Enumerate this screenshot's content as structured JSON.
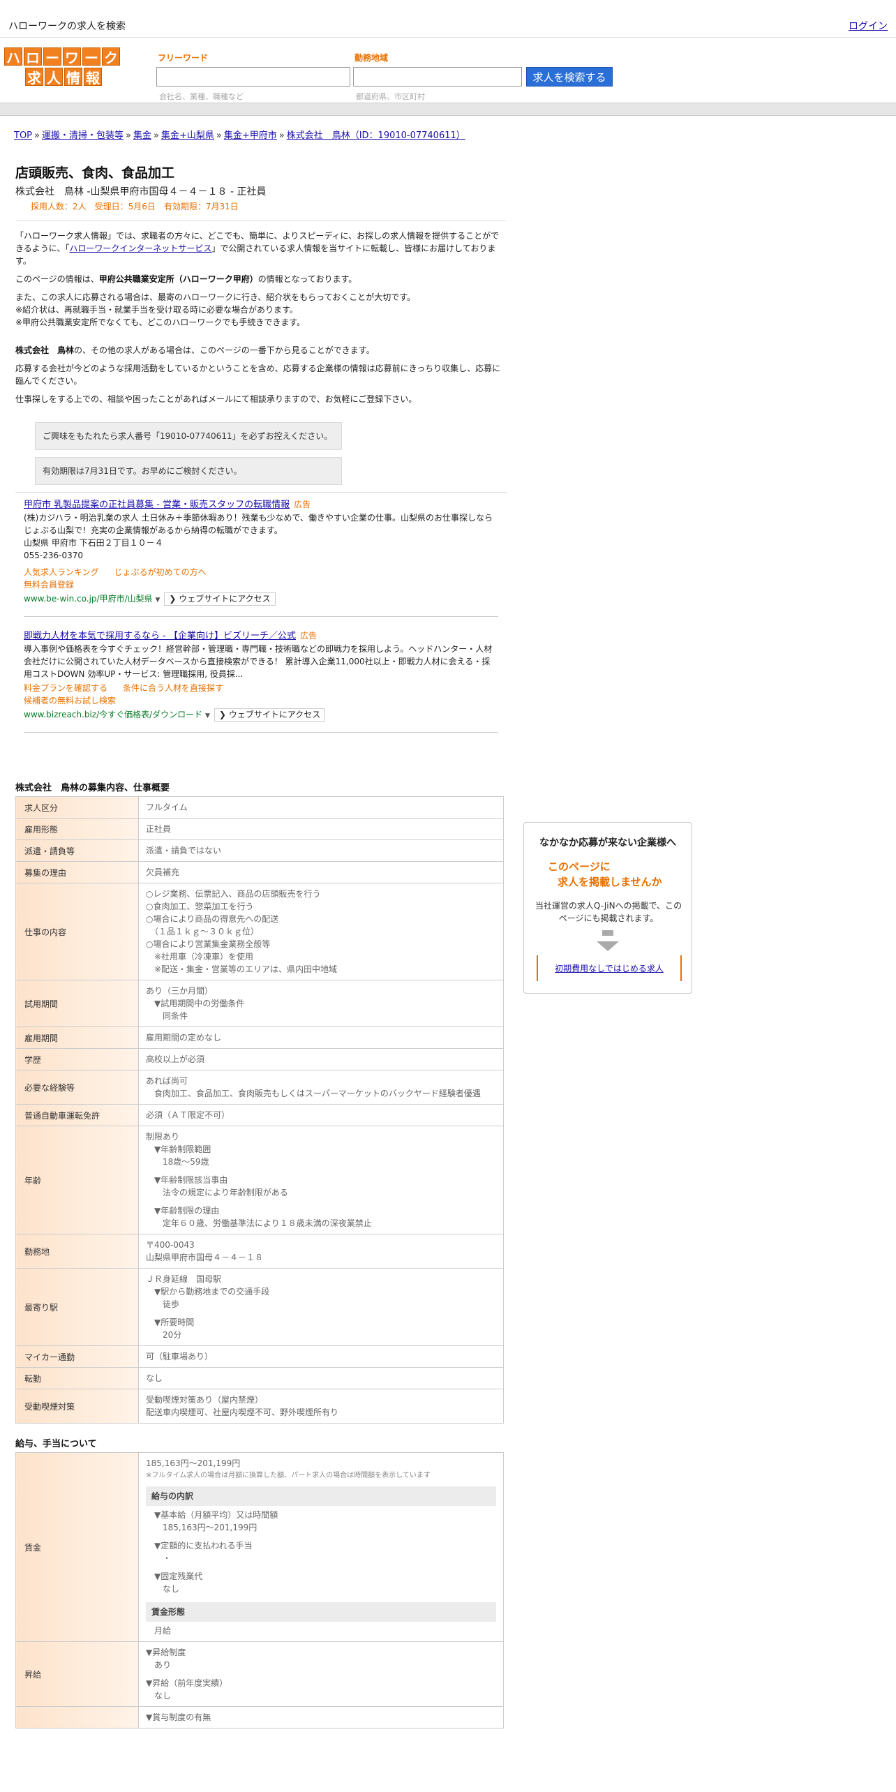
{
  "header": {
    "site_title": "ハローワークの求人を検索",
    "login": "ログイン",
    "logo_row1": [
      "ハ",
      "ロ",
      "ー",
      "ワ",
      "ー",
      "ク"
    ],
    "logo_row2": [
      "求",
      "人",
      "情",
      "報"
    ]
  },
  "search": {
    "keyword_label": "フリーワード",
    "keyword_hint": "会社名、業種、職種など",
    "area_label": "勤務地域",
    "area_hint": "都道府県、市区町村",
    "button": "求人を検索する"
  },
  "breadcrumb": [
    "TOP",
    "運搬・清掃・包装等",
    "集金",
    "集金+山梨県",
    "集金+甲府市",
    "株式会社　鳥林（ID：19010-07740611）"
  ],
  "job": {
    "title": "店頭販売、食肉、食品加工",
    "company_line": "株式会社　鳥林 -山梨県甲府市国母４－４－１８ - 正社員",
    "meta": "採用人数：2人　受理日：5月6日　有効期限：7月31日"
  },
  "intro": {
    "p1a": "「ハローワーク求人情報」では、求職者の方々に、どこでも、簡単に、よりスピーディに、お探しの求人情報を提供することができるように、「",
    "p1link": "ハローワークインターネットサービス",
    "p1b": "」で公開されている求人情報を当サイトに転載し、皆様にお届けしております。",
    "p2a": "このページの情報は、",
    "p2b": "甲府公共職業安定所（ハローワーク甲府）",
    "p2c": "の情報となっております。",
    "p3": "また、この求人に応募される場合は、最寄のハローワークに行き、紹介状をもらっておくことが大切です。",
    "p4": "※紹介状は、再就職手当・就業手当を受け取る時に必要な場合があります。",
    "p5": "※甲府公共職業安定所でなくても、どこのハローワークでも手続きできます。",
    "p6a": "株式会社　鳥林",
    "p6b": "の、その他の求人がある場合は、このページの一番下から見ることができます。",
    "p7": "応募する会社が今どのような採用活動をしているかということを含め、応募する企業様の情報は応募前にきっちり収集し、応募に臨んでください。",
    "p8": "仕事探しをする上での、相談や困ったことがあればメールにて相談承りますので、お気軽にご登録下さい。",
    "notice1": "ご興味をもたれたら求人番号「19010-07740611」を必ずお控えください。",
    "notice2": "有効期限は7月31日です。お早めにご検討ください。"
  },
  "ads": [
    {
      "title": "甲府市 乳製品提案の正社員募集 - 営業・販売スタッフの転職情報",
      "label": "広告",
      "text": "(株)カジハラ・明治乳業の求人 土日休み＋季節休暇あり！残業も少なめで、働きやすい企業の仕事。山梨県のお仕事探しならじょぶる山梨で！充実の企業情報があるから納得の転職ができます。",
      "address": "山梨県 甲府市 下石田２丁目１０－４",
      "phone": "055-236-0370",
      "links": [
        "人気求人ランキング",
        "じょぶるが初めての方へ",
        "無料会員登録"
      ],
      "url": "www.be-win.co.jp/甲府市/山梨県",
      "button": "ウェブサイトにアクセス"
    },
    {
      "title": "即戦力人材を本気で採用するなら - 【企業向け】ビズリーチ／公式",
      "label": "広告",
      "text": "導入事例や価格表を今すぐチェック！経営幹部・管理職・専門職・技術職などの即戦力を採用しよう。ヘッドハンター・人材会社だけに公開されていた人材データベースから直接検索ができる！ 累計導入企業11,000社以上・即戦力人材に会える・採用コストDOWN 効率UP・サービス: 管理職採用, 役員採...",
      "links": [
        "料金プランを確認する",
        "条件に合う人材を直接探す",
        "候補者の無料お試し検索"
      ],
      "url": "www.bizreach.biz/今すぐ価格表/ダウンロード",
      "button": "ウェブサイトにアクセス"
    }
  ],
  "overview": {
    "title": "株式会社　鳥林の募集内容、仕事概要",
    "rows": [
      {
        "k": "求人区分",
        "v": [
          "フルタイム"
        ]
      },
      {
        "k": "雇用形態",
        "v": [
          "正社員"
        ]
      },
      {
        "k": "派遣・請負等",
        "v": [
          "派遣・請負ではない"
        ]
      },
      {
        "k": "募集の理由",
        "v": [
          "欠員補充"
        ]
      },
      {
        "k": "仕事の内容",
        "v": [
          "○レジ業務、伝票記入、商品の店頭販売を行う",
          "○食肉加工、惣菜加工を行う",
          "○場合により商品の得意先への配送",
          "　（１品１ｋｇ～３０ｋｇ位）",
          "○場合により営業集金業務全般等",
          "　※社用車（冷凍車）を使用",
          "　※配送・集金・営業等のエリアは、県内田中地域"
        ]
      },
      {
        "k": "試用期間",
        "v": [
          "あり（三か月間）",
          "　▼試用期間中の労働条件",
          "　　同条件"
        ]
      },
      {
        "k": "雇用期間",
        "v": [
          "雇用期間の定めなし"
        ]
      },
      {
        "k": "学歴",
        "v": [
          "高校以上が必須"
        ]
      },
      {
        "k": "必要な経験等",
        "v": [
          "あれば尚可",
          "　食肉加工、食品加工、食肉販売もしくはスーパーマーケットのバックヤード経験者優遇"
        ]
      },
      {
        "k": "普通自動車運転免許",
        "v": [
          "必須（ＡＴ限定不可）"
        ]
      },
      {
        "k": "年齢",
        "v": [
          "制限あり",
          "　▼年齢制限範囲",
          "　　18歳〜59歳",
          "",
          "　▼年齢制限該当事由",
          "　　法令の規定により年齢制限がある",
          "",
          "　▼年齢制限の理由",
          "　　定年６０歳、労働基準法により１８歳未満の深夜業禁止"
        ]
      },
      {
        "k": "勤務地",
        "v": [
          "〒400-0043",
          "山梨県甲府市国母４－４－１８"
        ]
      },
      {
        "k": "最寄り駅",
        "v": [
          "ＪＲ身延線　国母駅",
          "　▼駅から勤務地までの交通手段",
          "　　徒歩",
          "",
          "　▼所要時間",
          "　　20分"
        ]
      },
      {
        "k": "マイカー通勤",
        "v": [
          "可（駐車場あり）"
        ]
      },
      {
        "k": "転勤",
        "v": [
          "なし"
        ]
      },
      {
        "k": "受動喫煙対策",
        "v": [
          "受動喫煙対策あり（屋内禁煙）",
          "配送車内喫煙可、社屋内喫煙不可、野外喫煙所有り"
        ]
      }
    ]
  },
  "salary": {
    "title": "給与、手当について",
    "wage_key": "賃金",
    "wage_range": "185,163円〜201,199円",
    "wage_note": "※フルタイム求人の場合は月額に換算した額、パート求人の場合は時間額を表示しています",
    "breakdown_head": "給与の内訳",
    "base_label": "▼基本給（月額平均）又は時間額",
    "base_value": "185,163円〜201,199円",
    "fixed_label": "▼定額的に支払われる手当",
    "fixed_value": "・",
    "ot_label": "▼固定残業代",
    "ot_value": "なし",
    "form_head": "賃金形態",
    "form_value": "月給",
    "raise_key": "昇給",
    "raise1_label": "▼昇給制度",
    "raise1_value": "あり",
    "raise2_label": "▼昇給（前年度実績）",
    "raise2_value": "なし",
    "bonus_label": "▼賞与制度の有無"
  },
  "side": {
    "title": "なかなか応募が来ない企業様へ",
    "hl1": "このページに",
    "hl2": "求人を掲載しませんか",
    "text": "当社運営の求人Q-JiNへの掲載で、このページにも掲載されます。",
    "link": "初期費用なしではじめる求人"
  },
  "colors": {
    "accent": "#e87000",
    "link": "#1a0dab",
    "button": "#2a6ed8",
    "url_green": "#0a7d2a"
  }
}
